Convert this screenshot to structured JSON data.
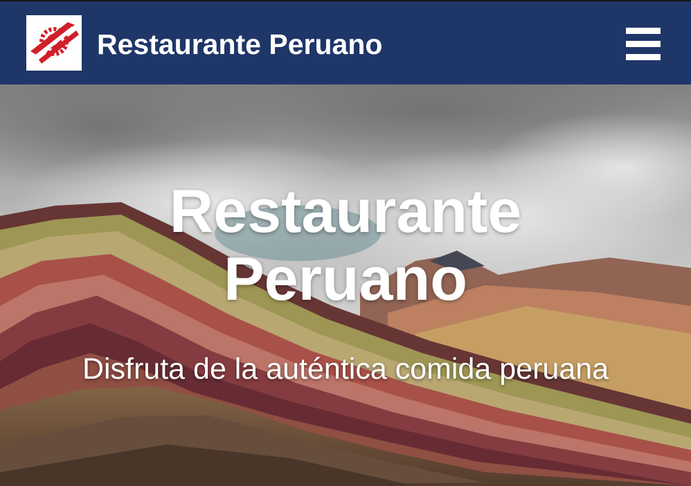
{
  "header": {
    "brand": "Restaurante Peruano",
    "logo_icon": "red-emblem-logo",
    "menu_icon": "hamburger-menu-icon",
    "background_color": "#1f3668"
  },
  "hero": {
    "title_line1": "Restaurante",
    "title_line2": "Peruano",
    "subtitle": "Disfruta de la auténtica comida peruana",
    "background_image": "rainbow-mountain-photo"
  }
}
